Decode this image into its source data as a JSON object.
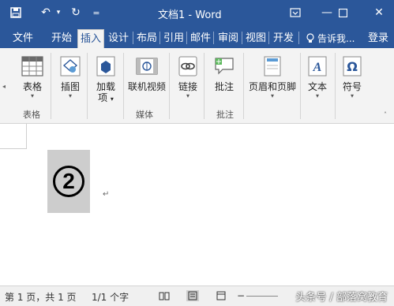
{
  "window": {
    "title": "文档1 - Word",
    "accent": "#2b579a"
  },
  "quick_access": {
    "more_label": "="
  },
  "tabs": [
    {
      "label": "文件"
    },
    {
      "label": "开始"
    },
    {
      "label": "插入"
    },
    {
      "label": "设计"
    },
    {
      "label": "布局"
    },
    {
      "label": "引用"
    },
    {
      "label": "邮件"
    },
    {
      "label": "审阅"
    },
    {
      "label": "视图"
    },
    {
      "label": "开发"
    },
    {
      "label": "告诉我..."
    },
    {
      "label": "登录"
    }
  ],
  "ribbon": {
    "table": {
      "label": "表格",
      "icon": "table-icon"
    },
    "illustrations": {
      "label": "插图",
      "icon": "illustrations-icon"
    },
    "addins": {
      "label_line1": "加载",
      "label_line2": "项",
      "icon": "addins-icon"
    },
    "online_video": {
      "label": "联机视频",
      "icon": "video-icon"
    },
    "links": {
      "label": "链接",
      "icon": "link-icon"
    },
    "comment": {
      "label": "批注",
      "icon": "comment-icon"
    },
    "header_footer": {
      "label": "页眉和页脚",
      "icon": "header-footer-icon"
    },
    "text": {
      "label": "文本",
      "icon": "text-icon"
    },
    "symbols": {
      "label": "符号",
      "icon": "symbol-icon"
    },
    "groups": {
      "tables": "表格",
      "media": "媒体",
      "comments": "批注"
    }
  },
  "document": {
    "circled_number": "②",
    "paragraph_mark": "↵"
  },
  "status": {
    "page": "第 1 页，共 1 页",
    "words": "1/1 个字",
    "watermark": "头条号 / 部落窝教育"
  }
}
